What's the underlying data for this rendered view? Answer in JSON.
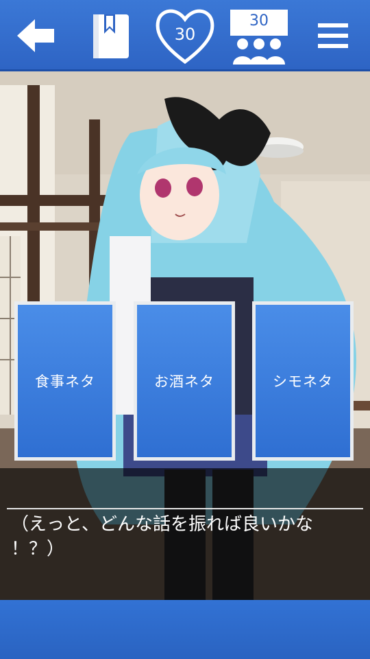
{
  "header": {
    "back_icon": "arrow-left-icon",
    "notebook_icon": "notebook-bookmark-icon",
    "affection_value": "30",
    "audience_value": "30",
    "menu_icon": "hamburger-menu-icon"
  },
  "choices": [
    {
      "label": "食事ネタ"
    },
    {
      "label": "お酒ネタ"
    },
    {
      "label": "シモネタ"
    }
  ],
  "dialog": {
    "text": "（えっと、どんな話を振れば良いかな\n！？）"
  },
  "colors": {
    "bar_blue": "#2e64c4",
    "choice_blue": "#3b7ddd"
  }
}
